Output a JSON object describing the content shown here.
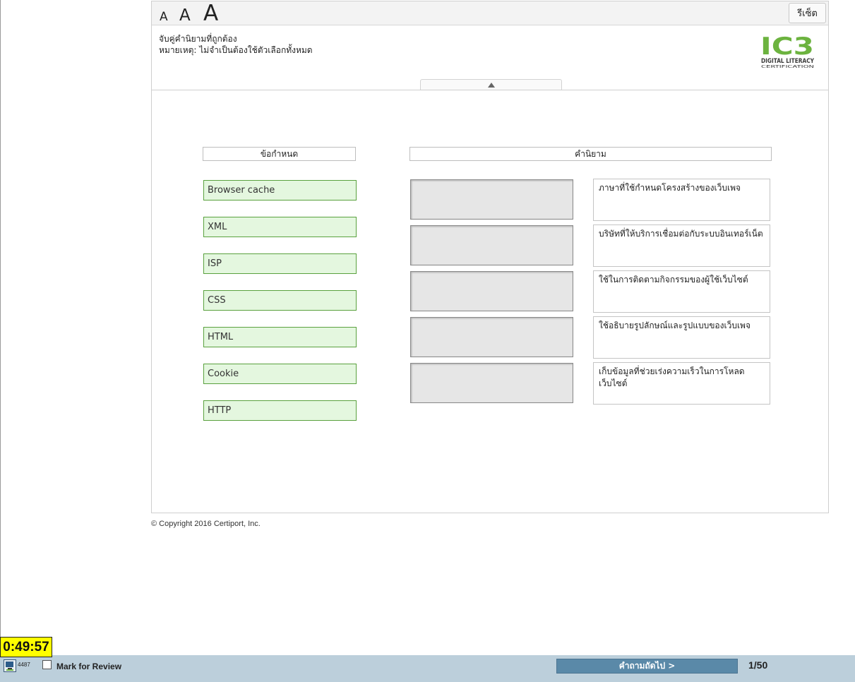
{
  "toolbar": {
    "font_small": "A",
    "font_medium": "A",
    "font_large": "A",
    "reset_label": "รีเซ็ต"
  },
  "instructions": {
    "line1": "จับคู่คำนิยามที่ถูกต้อง",
    "line2": "หมายเหตุ: ไม่จำเป็นต้องใช้ตัวเลือกทั้งหมด"
  },
  "logo": {
    "brand": "IC3",
    "line1": "DIGITAL LITERACY",
    "line2": "CERTIFICATION",
    "colors": {
      "green": "#6cb33f",
      "dark": "#3a3a3a"
    }
  },
  "columns": {
    "terms_header": "ข้อกำหนด",
    "definitions_header": "คำนิยาม"
  },
  "terms": [
    {
      "label": "Browser cache"
    },
    {
      "label": "XML"
    },
    {
      "label": "ISP"
    },
    {
      "label": "CSS"
    },
    {
      "label": "HTML"
    },
    {
      "label": "Cookie"
    },
    {
      "label": "HTTP"
    }
  ],
  "definitions": [
    {
      "text": "ภาษาที่ใช้กำหนดโครงสร้างของเว็บเพจ"
    },
    {
      "text": "บริษัทที่ให้บริการเชื่อมต่อกับระบบอินเทอร์เน็ต"
    },
    {
      "text": "ใช้ในการติดตามกิจกรรมของผู้ใช้เว็บไซต์"
    },
    {
      "text": "ใช้อธิบายรูปลักษณ์และรูปแบบของเว็บเพจ"
    },
    {
      "text": "เก็บข้อมูลที่ช่วยเร่งความเร็วในการโหลดเว็บไซต์"
    }
  ],
  "footer": {
    "copyright": "© Copyright 2016 Certiport, Inc."
  },
  "statusbar": {
    "timer": "0:49:57",
    "exam_id": "4487",
    "mark_for_review": "Mark for Review",
    "next_label": "คำถามถัดไป >",
    "page_count": "1/50"
  },
  "colors": {
    "term_bg": "#e4f7df",
    "term_border": "#5aa13e",
    "slot_bg": "#e6e6e6",
    "next_button": "#5a89a8",
    "statusbar_bg": "#bccfdb",
    "timer_bg": "#ffff00"
  }
}
